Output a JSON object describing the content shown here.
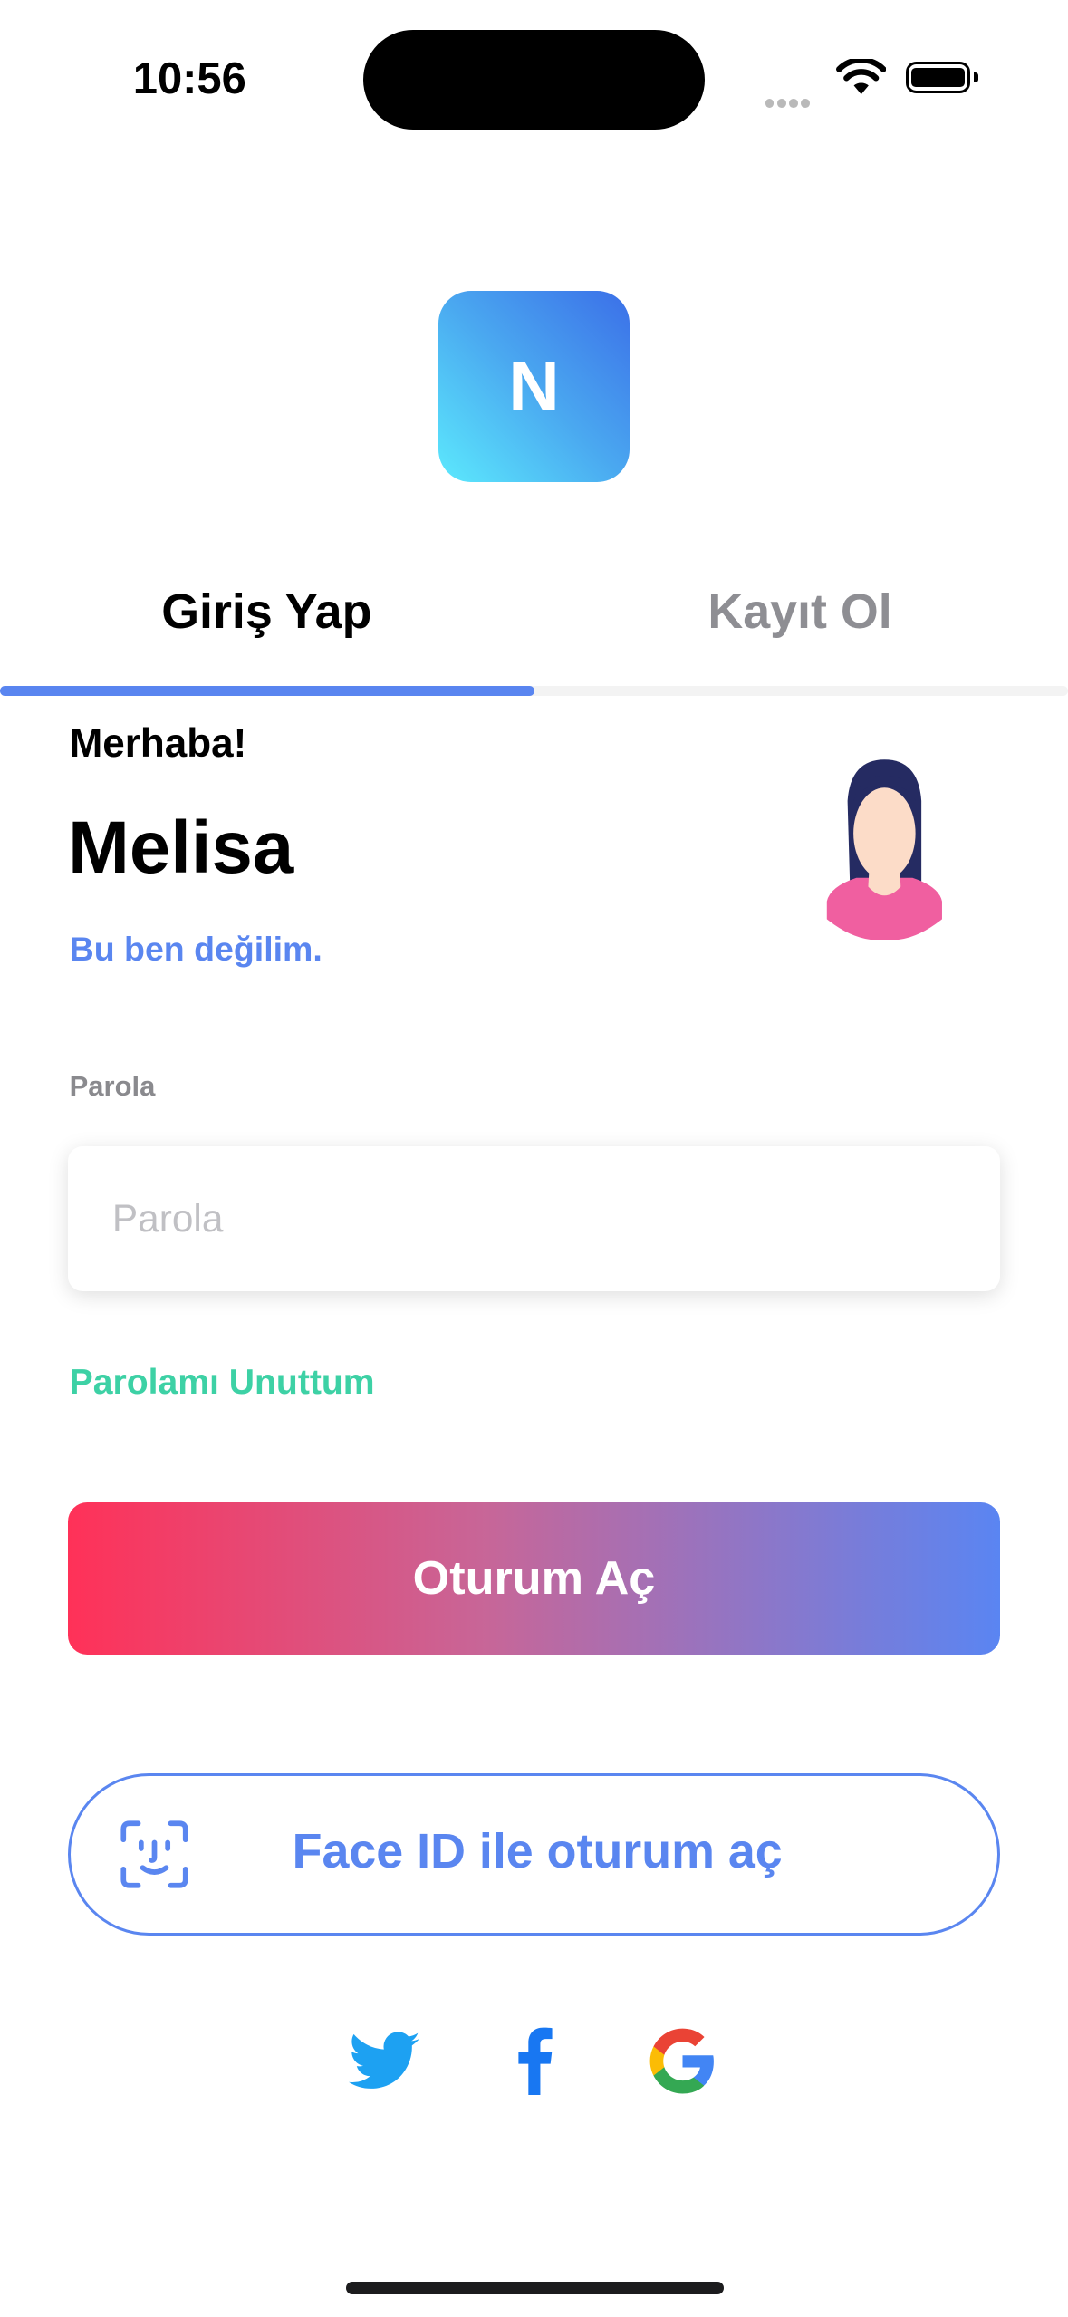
{
  "status_bar": {
    "time": "10:56"
  },
  "logo": {
    "letter": "N"
  },
  "tabs": [
    {
      "label": "Giriş Yap",
      "active": true
    },
    {
      "label": "Kayıt Ol",
      "active": false
    }
  ],
  "greeting": {
    "hello": "Merhaba!",
    "name": "Melisa",
    "not_me_link": "Bu ben değilim."
  },
  "password": {
    "label": "Parola",
    "placeholder": "Parola",
    "value": ""
  },
  "forgot_link": "Parolamı Unuttum",
  "login_button": "Oturum Aç",
  "faceid_button": "Face ID ile oturum aç",
  "social": [
    "twitter-icon",
    "facebook-icon",
    "google-icon"
  ],
  "colors": {
    "accent": "#5a86f0",
    "forgot": "#3dd1a5",
    "gradient_start": "#ff3158",
    "gradient_end": "#5a85f2"
  }
}
